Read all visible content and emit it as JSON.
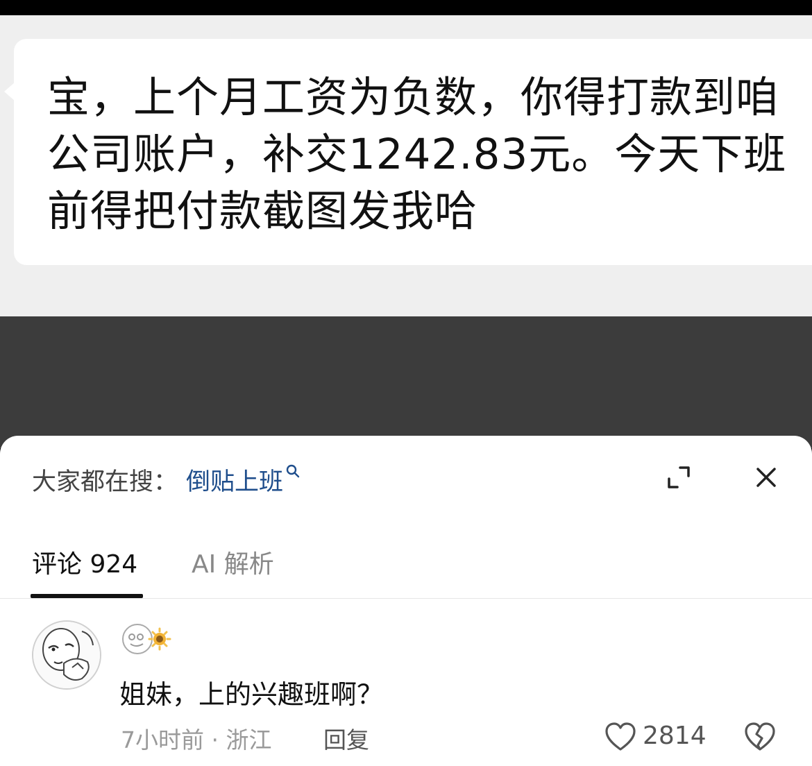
{
  "message": {
    "text": "宝，上个月工资为负数，你得打款到咱公司账户，补交1242.83元。今天下班前得把付款截图发我哈"
  },
  "search": {
    "prefix": "大家都在搜：",
    "keyword": "倒贴上班"
  },
  "tabs": [
    {
      "label": "评论 924",
      "active": true
    },
    {
      "label": "AI 解析",
      "active": false
    }
  ],
  "comment": {
    "text": "姐妹，上的兴趣班啊？",
    "time_location": "7小时前 · 浙江",
    "reply_label": "回复",
    "likes": "2814"
  },
  "colors": {
    "keyword": "#1f4e8c",
    "chat_background": "#efefef",
    "dark_band": "#3c3c3c"
  }
}
